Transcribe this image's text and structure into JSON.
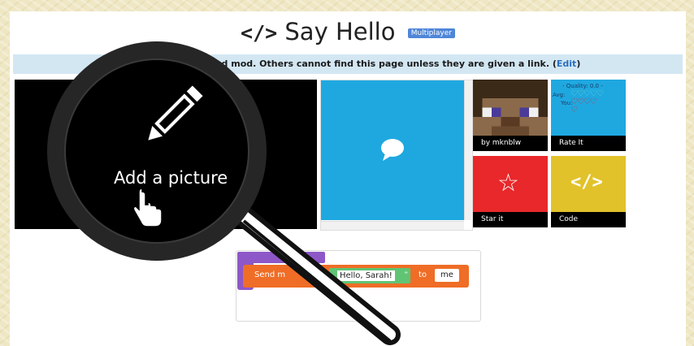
{
  "header": {
    "title": "Say Hello",
    "code_icon": "</>",
    "badge": "Multiplayer"
  },
  "notice": {
    "text": "N                    ublished mod. Others cannot find this page unless they are given a link. (",
    "edit_label": "Edit",
    "close_paren": ")"
  },
  "picture": {
    "label": "Add a picture"
  },
  "tiles": {
    "author": {
      "caption": "by mknblw"
    },
    "rate": {
      "caption": "Rate It",
      "quality": "- Quality: 0.0 -",
      "avg_label": "Avg:",
      "you_label": "You:"
    },
    "star": {
      "caption": "Star it",
      "icon": "☆"
    },
    "code": {
      "caption": "Code",
      "icon": "</>"
    }
  },
  "editor": {
    "send_label": "Send m",
    "message_value": "Hello, Sarah!",
    "quote_mark": "”",
    "to_label": "to",
    "target_value": "me"
  },
  "colors": {
    "accent_blue": "#1fa8e0",
    "star_red": "#e8282a",
    "code_yellow": "#e2c22a",
    "block_orange": "#ef6d26",
    "block_purple": "#8d57c8",
    "block_green": "#5fc574",
    "notice_bg": "#d3e7f3",
    "badge_blue": "#4f86d8"
  },
  "icons": [
    "code-icon",
    "pencil-icon",
    "hand-cursor-icon",
    "magnifier-icon",
    "speech-bubble-icon",
    "heart-icon",
    "star-icon",
    "avatar-icon"
  ]
}
